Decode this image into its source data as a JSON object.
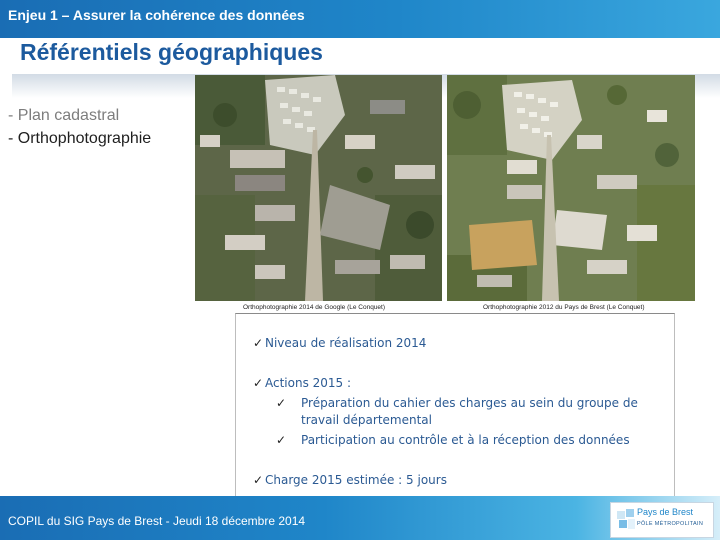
{
  "header": {
    "title": "Enjeu 1 – Assurer la cohérence des données"
  },
  "slide": {
    "title": "Référentiels géographiques",
    "bullets": [
      "- Plan cadastral",
      "- Orthophotographie"
    ]
  },
  "photos": [
    {
      "caption": "Orthophotographie 2014 de Google (Le Conquet)"
    },
    {
      "caption": "Orthophotographie 2012 du Pays de Brest (Le Conquet)"
    }
  ],
  "status_box": {
    "items": [
      {
        "text": "Niveau de réalisation 2014"
      },
      {
        "text": "Actions 2015 :",
        "subitems": [
          "Préparation du cahier des charges au sein du groupe de travail départemental",
          "Participation au contrôle et à la réception des données"
        ]
      },
      {
        "text": "Charge 2015 estimée : 5 jours"
      }
    ],
    "check_glyph": "✓"
  },
  "footer": {
    "text": "COPIL du SIG Pays de Brest - Jeudi 18 décembre 2014"
  },
  "logo": {
    "name": "Pays de Brest",
    "subtitle": "PÔLE MÉTROPOLITAIN"
  },
  "colors": {
    "header_blue": "#1a6db4",
    "title_blue": "#1c5a9e",
    "item_blue": "#2b5a93"
  },
  "icons": [
    "check-icon",
    "pays-de-brest-logo-mark"
  ]
}
